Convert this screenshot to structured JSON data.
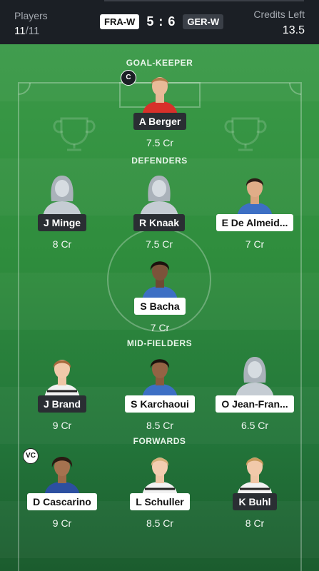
{
  "header": {
    "players_label": "Players",
    "players_count": "11",
    "players_total": "/11",
    "team_home": "FRA-W",
    "score": "5 : 6",
    "team_away": "GER-W",
    "credits_label": "Credits Left",
    "credits_value": "13.5"
  },
  "sections": {
    "goalkeeper": "GOAL-KEEPER",
    "defenders": "DEFENDERS",
    "midfielders": "MID-FIELDERS",
    "forwards": "FORWARDS"
  },
  "badges": {
    "captain": "C",
    "vice_captain": "VC"
  },
  "players": {
    "gk1": {
      "name": "A Berger",
      "credits": "7.5 Cr"
    },
    "def1": {
      "name": "J Minge",
      "credits": "8 Cr"
    },
    "def2": {
      "name": "R Knaak",
      "credits": "7.5 Cr"
    },
    "def3": {
      "name": "E De Almeid...",
      "credits": "7 Cr"
    },
    "def4": {
      "name": "S Bacha",
      "credits": "7 Cr"
    },
    "mid1": {
      "name": "J Brand",
      "credits": "9 Cr"
    },
    "mid2": {
      "name": "S Karchaoui",
      "credits": "8.5 Cr"
    },
    "mid3": {
      "name": "O Jean-Fran...",
      "credits": "6.5 Cr"
    },
    "fwd1": {
      "name": "D Cascarino",
      "credits": "9 Cr"
    },
    "fwd2": {
      "name": "L Schuller",
      "credits": "8.5 Cr"
    },
    "fwd3": {
      "name": "K Buhl",
      "credits": "8 Cr"
    }
  },
  "colors": {
    "header_bg": "#1b1f25",
    "pitch_green": "#2f8d3d",
    "france_kit": "#3d6fc4",
    "germany_kit": "#f2f2f2",
    "keeper_kit": "#d8302a"
  }
}
